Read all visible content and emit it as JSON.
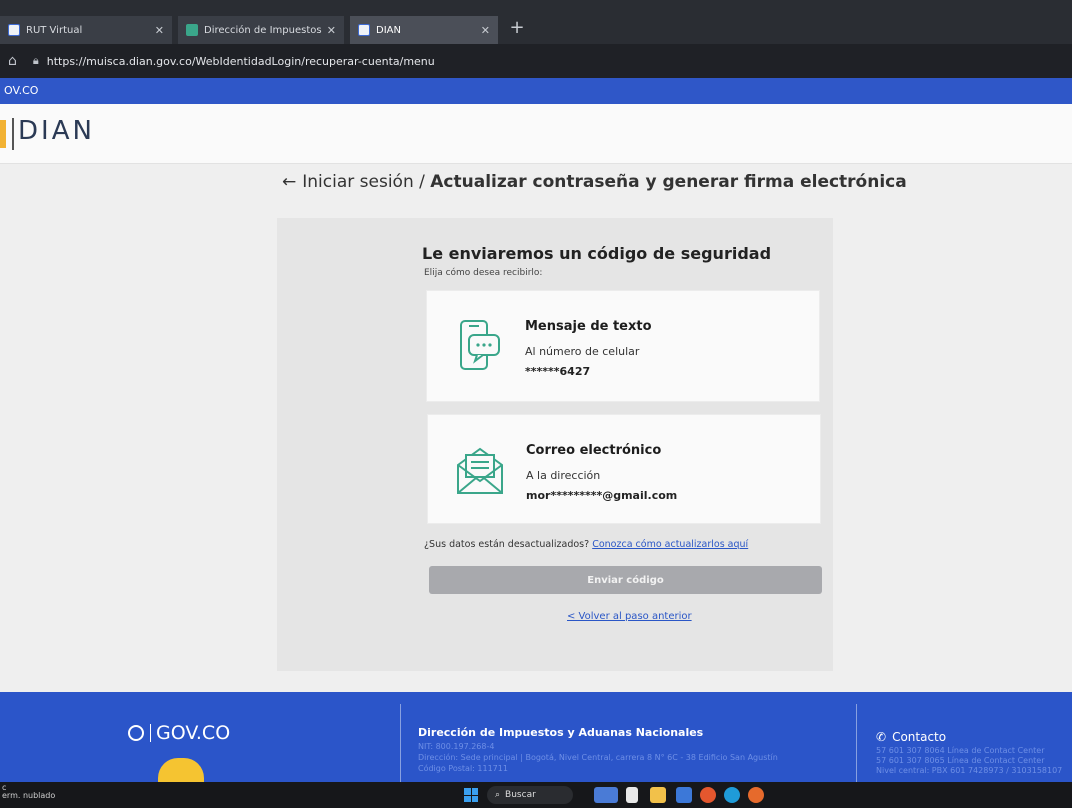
{
  "browser": {
    "tabs": [
      {
        "label": "RUT Virtual"
      },
      {
        "label": "Dirección de Impuestos y Aduan"
      },
      {
        "label": "DIAN"
      }
    ],
    "new_tab": "+",
    "url": "https://muisca.dian.gov.co/WebIdentidadLogin/recuperar-cuenta/menu"
  },
  "gov_bar": {
    "label": "OV.CO"
  },
  "brand": {
    "logo_text": "DIAN"
  },
  "breadcrumb": {
    "back_arrow": "←",
    "parent": "Iniciar sesión",
    "separator": " / ",
    "current": "Actualizar contraseña y generar firma electrónica"
  },
  "card": {
    "title": "Le enviaremos un código de seguridad",
    "subtitle": "Elija cómo desea recibirlo:",
    "options": [
      {
        "title": "Mensaje de texto",
        "line": "Al número de celular",
        "masked": "******6427"
      },
      {
        "title": "Correo electrónico",
        "line": "A la dirección",
        "masked": "mor*********@gmail.com"
      }
    ],
    "outdated_text": "¿Sus datos están desactualizados?",
    "outdated_link": "Conozca cómo actualizarlos aquí",
    "send_button": "Enviar código",
    "back_link": "< Volver al paso anterior"
  },
  "footer": {
    "gov_logo": "GOV.CO",
    "org_name": "Dirección de Impuestos y Aduanas Nacionales",
    "org_lines": [
      "NIT: 800.197.268-4",
      "Dirección: Sede principal | Bogotá, Nivel Central, carrera 8 N° 6C - 38 Edificio San Agustín",
      "Código Postal: 111711"
    ],
    "contact_title": "Contacto",
    "contact_lines": [
      "57 601 307 8064 Línea de Contact Center",
      "57 601 307 8065 Línea de Contact Center",
      "Nivel central: PBX 601 7428973 / 3103158107"
    ]
  },
  "taskbar": {
    "weather": "c\nerm. nublado",
    "search": "Buscar"
  },
  "colors": {
    "gov_blue": "#2f57c8",
    "icon_teal": "#3aa68a",
    "link_blue": "#2a56c6",
    "button_disabled": "#a8a9ad"
  }
}
